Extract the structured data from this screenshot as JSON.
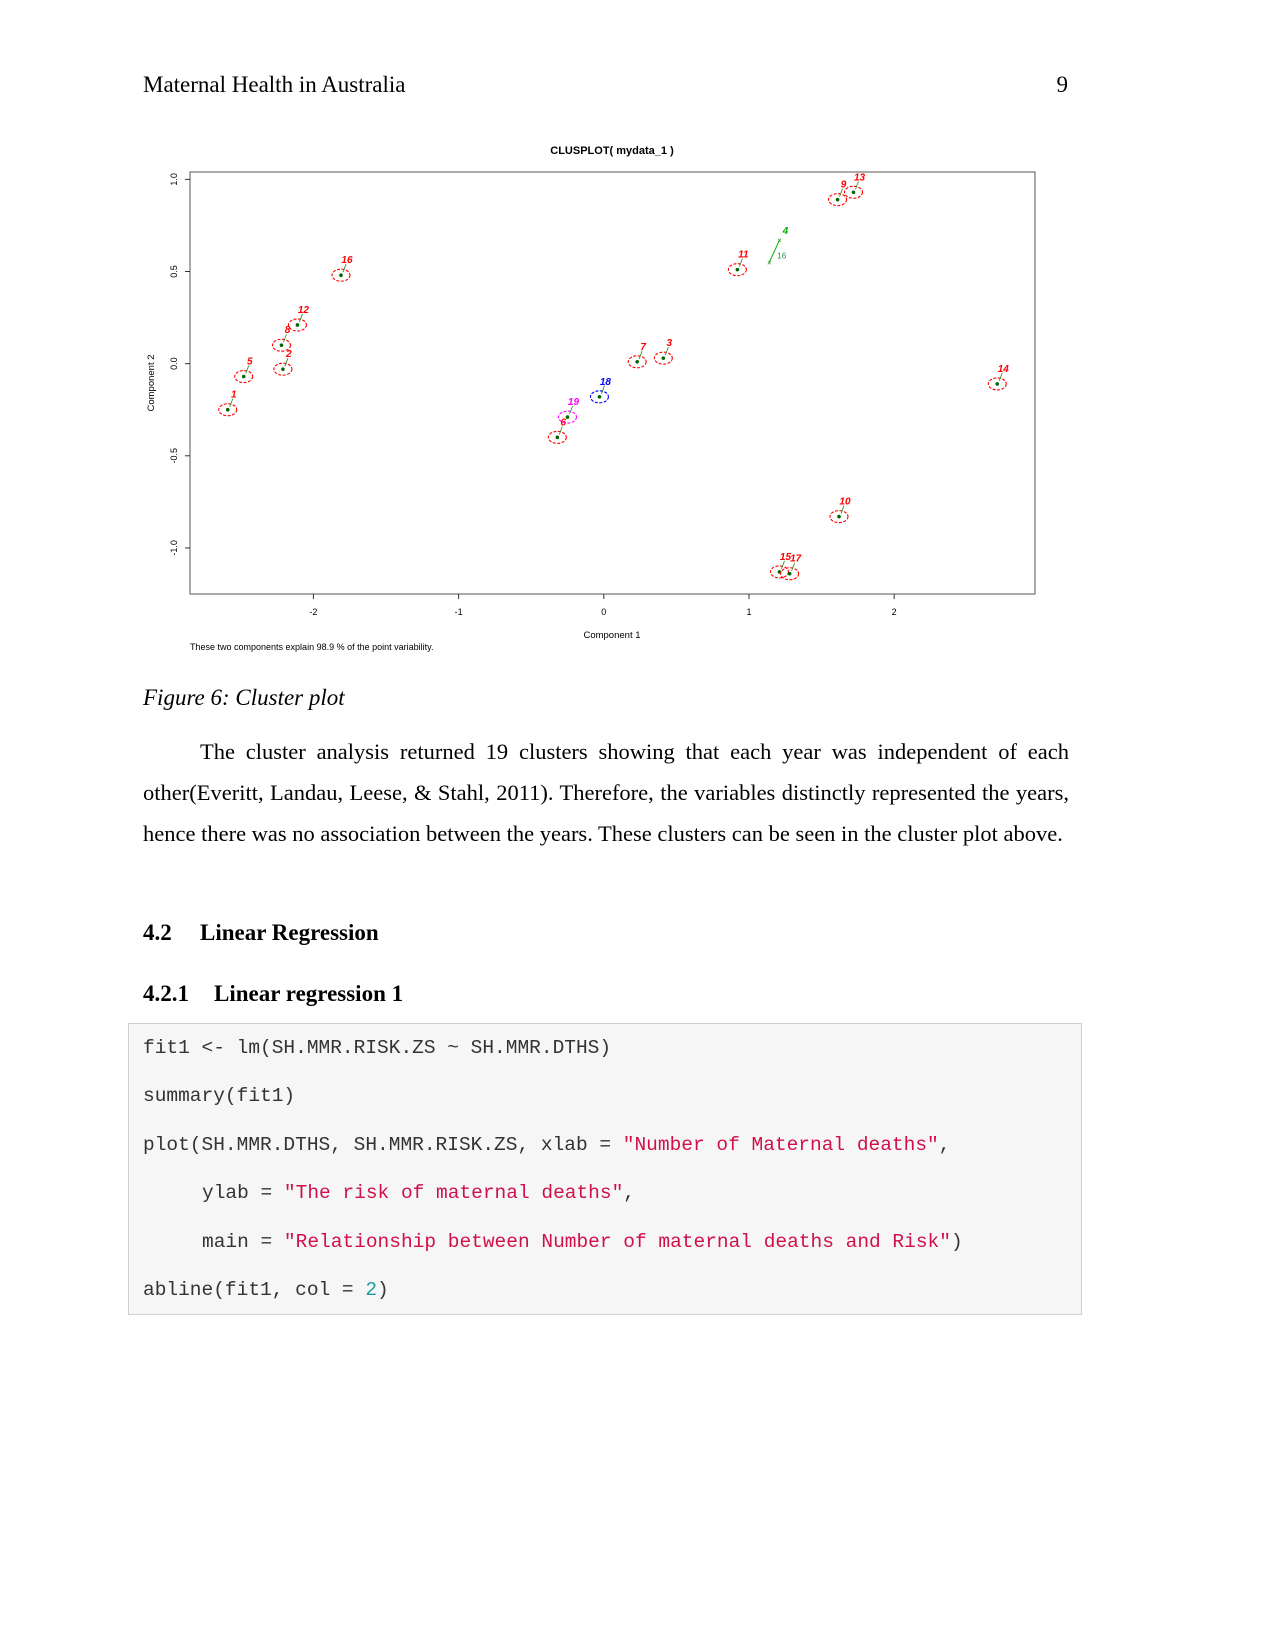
{
  "header": {
    "title": "Maternal Health in Australia",
    "page_number": "9"
  },
  "figure": {
    "caption": "Figure 6: Cluster plot"
  },
  "chart_data": {
    "type": "scatter",
    "title": "CLUSPLOT( mydata_1 )",
    "xlabel": "Component 1",
    "ylabel": "Component 2",
    "subtitle": "These two components explain 98.9 % of the point variability.",
    "xlim": [
      -2.85,
      2.97
    ],
    "ylim": [
      -1.25,
      1.04
    ],
    "xticks": [
      "-2",
      "-1",
      "0",
      "1",
      "2"
    ],
    "yticks": [
      "-1.0",
      "-0.5",
      "0.0",
      "0.5",
      "1.0"
    ],
    "grid": false,
    "clusters": [
      {
        "label": "1",
        "x": -2.59,
        "y": -0.25,
        "color": "#ff0000"
      },
      {
        "label": "5",
        "x": -2.48,
        "y": -0.07,
        "color": "#ff0000"
      },
      {
        "label": "2",
        "x": -2.21,
        "y": -0.03,
        "color": "#ff0000"
      },
      {
        "label": "8",
        "x": -2.22,
        "y": 0.1,
        "color": "#ff0000"
      },
      {
        "label": "12",
        "x": -2.11,
        "y": 0.21,
        "color": "#ff0000"
      },
      {
        "label": "16",
        "x": -1.81,
        "y": 0.48,
        "color": "#ff0000"
      },
      {
        "label": "6",
        "x": -0.32,
        "y": -0.4,
        "color": "#ff0000"
      },
      {
        "label": "19",
        "x": -0.25,
        "y": -0.29,
        "color": "#ff00ff"
      },
      {
        "label": "18",
        "x": -0.03,
        "y": -0.18,
        "color": "#0000ff"
      },
      {
        "label": "7",
        "x": 0.23,
        "y": 0.01,
        "color": "#ff0000"
      },
      {
        "label": "3",
        "x": 0.41,
        "y": 0.03,
        "color": "#ff0000"
      },
      {
        "label": "11",
        "x": 0.92,
        "y": 0.51,
        "color": "#ff0000"
      },
      {
        "label": "9",
        "x": 1.61,
        "y": 0.89,
        "color": "#ff0000"
      },
      {
        "label": "13",
        "x": 1.72,
        "y": 0.93,
        "color": "#ff0000"
      },
      {
        "label": "14",
        "x": 2.71,
        "y": -0.11,
        "color": "#ff0000"
      },
      {
        "label": "10",
        "x": 1.62,
        "y": -0.83,
        "color": "#ff0000"
      },
      {
        "label": "15",
        "x": 1.21,
        "y": -1.13,
        "color": "#ff0000"
      },
      {
        "label": "17",
        "x": 1.28,
        "y": -1.14,
        "color": "#ff0000"
      }
    ],
    "segment_cluster": {
      "label": "4",
      "point_label": "16",
      "from": [
        1.14,
        0.55
      ],
      "to": [
        1.21,
        0.67
      ],
      "color": "#00b000"
    }
  },
  "body": {
    "paragraph": "The cluster analysis returned 19 clusters showing that each year was independent of each other(Everitt, Landau, Leese, & Stahl, 2011). Therefore, the variables distinctly represented the years, hence there was no association between the years. These clusters can be seen in the cluster plot above.",
    "section": {
      "number": "4.2",
      "title": "Linear Regression"
    },
    "subsection": {
      "number": "4.2.1",
      "title": "Linear regression 1"
    }
  },
  "code": {
    "line1": "fit1 <- lm(SH.MMR.RISK.ZS ~ SH.MMR.DTHS)",
    "line2": "summary(fit1)",
    "line3_a": "plot(SH.MMR.DTHS, SH.MMR.RISK.ZS, xlab = ",
    "line3_str": "\"Number of Maternal deaths\"",
    "line3_b": ",",
    "line4_a": "ylab = ",
    "line4_str": "\"The risk of maternal deaths\"",
    "line4_b": ",",
    "line5_a": "main = ",
    "line5_str": "\"Relationship between Number of maternal deaths and Risk\"",
    "line5_b": ")",
    "line6_a": "abline(fit1, col = ",
    "line6_num": "2",
    "line6_b": ")"
  }
}
